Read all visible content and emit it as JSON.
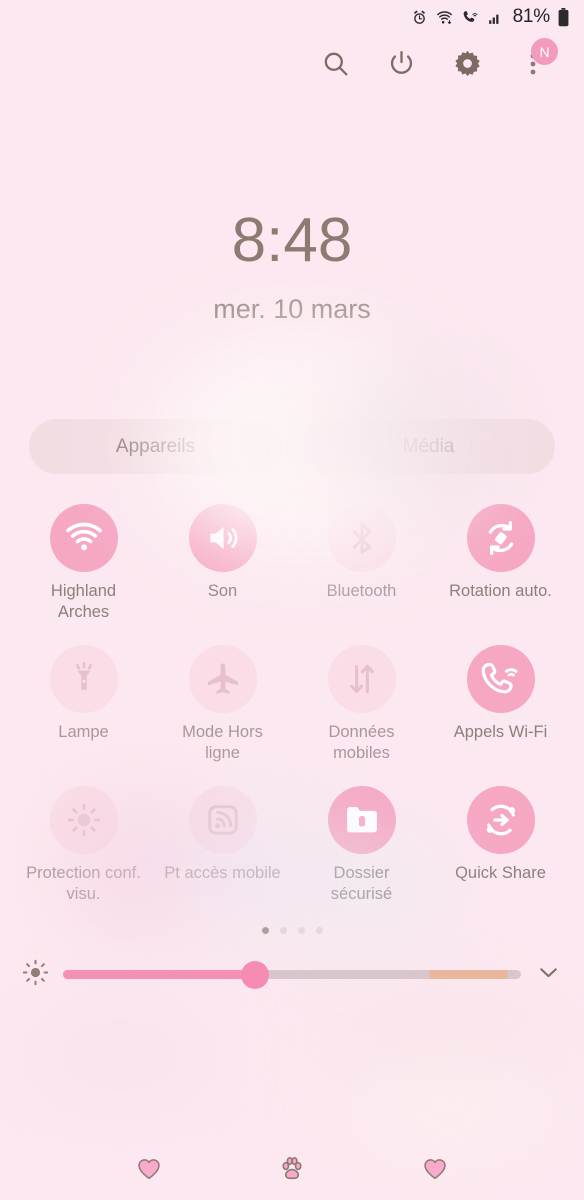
{
  "status_bar": {
    "icons": [
      "alarm-icon",
      "wifi-icon",
      "wifi-calling-icon",
      "signal-icon"
    ],
    "battery_percent": "81%",
    "battery_icon": "battery-icon"
  },
  "header": {
    "actions": [
      {
        "name": "search-button",
        "icon": "search-icon"
      },
      {
        "name": "power-button",
        "icon": "power-icon"
      },
      {
        "name": "settings-button",
        "icon": "gear-icon"
      },
      {
        "name": "more-options-button",
        "icon": "three-dots-icon",
        "badge": "N"
      }
    ]
  },
  "clock": {
    "time": "8:48",
    "date": "mer. 10 mars"
  },
  "pills": [
    {
      "label": "Appareils"
    },
    {
      "label": "Média"
    }
  ],
  "toggles": [
    {
      "label": "Highland Arches",
      "icon": "wifi-icon",
      "state": "on"
    },
    {
      "label": "Son",
      "icon": "volume-icon",
      "state": "on"
    },
    {
      "label": "Bluetooth",
      "icon": "bluetooth-icon",
      "state": "off"
    },
    {
      "label": "Rotation auto.",
      "icon": "rotation-icon",
      "state": "on"
    },
    {
      "label": "Lampe",
      "icon": "flashlight-icon",
      "state": "off"
    },
    {
      "label": "Mode Hors ligne",
      "icon": "airplane-icon",
      "state": "off"
    },
    {
      "label": "Données mobiles",
      "icon": "data-transfer-icon",
      "state": "off"
    },
    {
      "label": "Appels Wi-Fi",
      "icon": "wifi-calling-icon",
      "state": "on"
    },
    {
      "label": "Protection conf. visu.",
      "icon": "eye-comfort-icon",
      "state": "off"
    },
    {
      "label": "Pt accès mobile",
      "icon": "hotspot-icon",
      "state": "off"
    },
    {
      "label": "Dossier sécurisé",
      "icon": "secure-folder-icon",
      "state": "on"
    },
    {
      "label": "Quick Share",
      "icon": "quick-share-icon",
      "state": "on"
    }
  ],
  "pager": {
    "total": 4,
    "active_index": 0
  },
  "brightness": {
    "icon": "brightness-icon",
    "expand_icon": "chevron-down-icon",
    "value_percent": 42
  },
  "nav_bar": [
    {
      "name": "nav-recents-button",
      "icon": "heart-icon"
    },
    {
      "name": "nav-home-button",
      "icon": "paw-icon"
    },
    {
      "name": "nav-back-button",
      "icon": "heart-icon"
    }
  ],
  "colors": {
    "background": "#fce8f0",
    "accent_pink": "#f6a8c3",
    "slider_pink": "#f490b3",
    "text_brown": "#8d7f7c",
    "clock_brown": "#8d7a72"
  }
}
